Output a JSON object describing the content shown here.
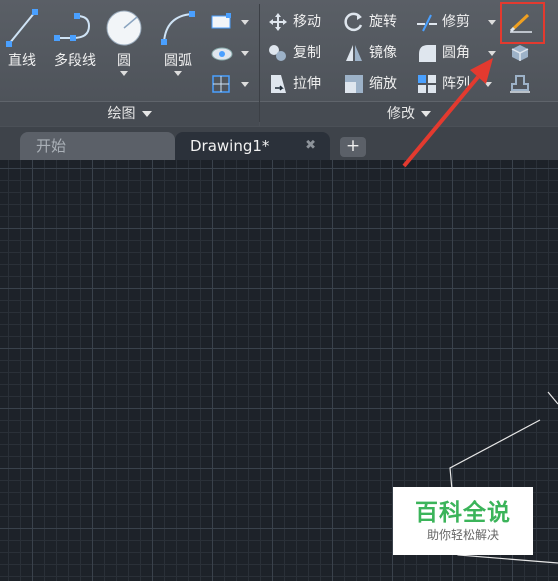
{
  "draw_panel": {
    "title": "绘图",
    "line_label": "直线",
    "polyline_label": "多段线",
    "circle_label": "圆",
    "arc_label": "圆弧"
  },
  "modify_panel": {
    "title": "修改",
    "move_label": "移动",
    "rotate_label": "旋转",
    "trim_label": "修剪",
    "copy_label": "复制",
    "mirror_label": "镜像",
    "fillet_label": "圆角",
    "stretch_label": "拉伸",
    "scale_label": "缩放",
    "array_label": "阵列"
  },
  "tabs": {
    "start_label": "开始",
    "drawing_label": "Drawing1*",
    "close_glyph": "✖",
    "new_glyph": "+"
  },
  "watermark": {
    "title": "百科全说",
    "subtitle": "助你轻松解决"
  },
  "colors": {
    "highlight_box": "#e33a2f",
    "arrow": "#e33a2f",
    "watermark_green": "#3bb45a"
  }
}
